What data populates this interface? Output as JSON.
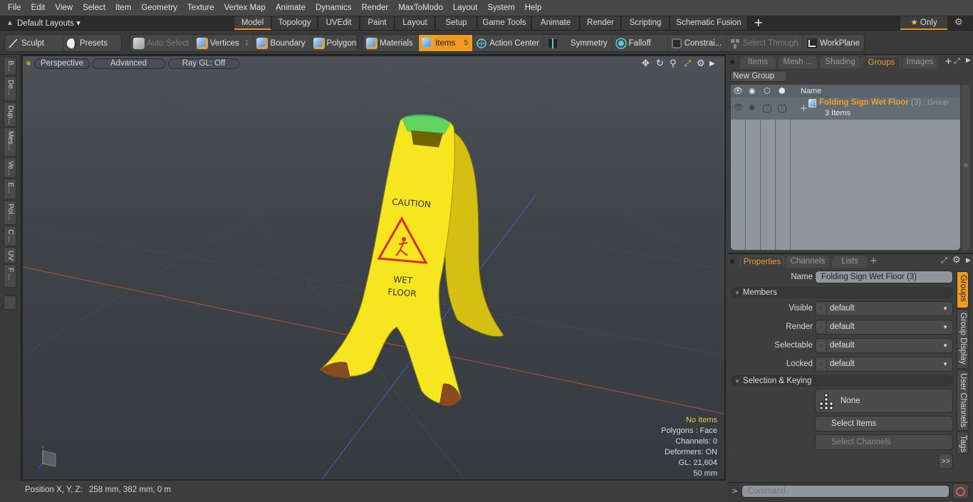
{
  "menu": [
    "File",
    "Edit",
    "View",
    "Select",
    "Item",
    "Geometry",
    "Texture",
    "Vertex Map",
    "Animate",
    "Dynamics",
    "Render",
    "MaxToModo",
    "Layout",
    "System",
    "Help"
  ],
  "layout_bar": {
    "layouts_label": "Default Layouts ▾",
    "tabs": [
      "Model",
      "Topology",
      "UVEdit",
      "Paint",
      "Layout",
      "Setup",
      "Game Tools",
      "Animate",
      "Render",
      "Scripting",
      "Schematic Fusion"
    ],
    "active_tab": "Model",
    "add_label": "+",
    "only_label": "Only",
    "only_star": "★",
    "gear": "⚙"
  },
  "toolbar": {
    "sculpt": "Sculpt",
    "presets": "Presets",
    "auto_select": "Auto Select",
    "vertices": "Vertices",
    "vertices_count": "1",
    "boundary": "Boundary",
    "polygons": "Polygons",
    "materials": "Materials",
    "items": "Items",
    "items_count": "5",
    "action_center": "Action Center",
    "symmetry": "Symmetry",
    "falloff": "Falloff",
    "constraints": "Constrai...",
    "select_through": "Select Through",
    "workplane": "WorkPlane"
  },
  "left_tabs": [
    "B...",
    "De...",
    "Dup...",
    "Mes...",
    "Ve...",
    "E...",
    "Pol...",
    "C ...",
    "UV",
    "F ..."
  ],
  "viewport": {
    "view_mode": "Perspective",
    "shading": "Advanced",
    "raygl": "Ray GL: Off",
    "icons": [
      "move-view-icon",
      "rotate-view-icon",
      "zoom-view-icon",
      "maximize-icon",
      "gear-icon",
      "play-arrow-icon"
    ],
    "stats": {
      "selection": "No Items",
      "mode": "Polygons : Face",
      "channels": "Channels: 0",
      "deformers": "Deformers: ON",
      "gl": "GL: 21,604",
      "grid": "50 mm"
    },
    "sign_text": {
      "caution": "CAUTION",
      "wet": "WET",
      "floor": "FLOOR"
    },
    "axis_labels": {
      "y": "Y",
      "x": "X",
      "z": "Z"
    }
  },
  "status_bar": {
    "position_label": "Position X, Y, Z:",
    "position_value": "258 mm, 382 mm, 0 m"
  },
  "groups_panel": {
    "tabs": [
      "Items",
      "Mesh ...",
      "Shading",
      "Groups",
      "Images"
    ],
    "active_tab": "Groups",
    "new_group": "New Group",
    "column_name": "Name",
    "row": {
      "name": "Folding Sign Wet Floor",
      "count": "(3)",
      "type": ": Group",
      "items": "3 Items",
      "expand": "+"
    }
  },
  "properties_panel": {
    "tabs": [
      "Properties",
      "Channels",
      "Lists"
    ],
    "active_tab": "Properties",
    "add": "+",
    "name_label": "Name",
    "name_value": "Folding Sign Wet Floor (3)",
    "members_section": "Members",
    "fields": [
      {
        "label": "Visible",
        "value": "default"
      },
      {
        "label": "Render",
        "value": "default"
      },
      {
        "label": "Selectable",
        "value": "default"
      },
      {
        "label": "Locked",
        "value": "default"
      }
    ],
    "selection_section": "Selection & Keying",
    "none_label": "None",
    "select_items": "Select Items",
    "select_channels": "Select Channels",
    "more": ">>",
    "side_tabs": [
      "Groups",
      "Group Display",
      "User Channels",
      "Tags"
    ],
    "active_side_tab": "Groups"
  },
  "command": {
    "prompt": ">",
    "placeholder": "Command"
  },
  "colors": {
    "accent": "#f09a20",
    "highlight_text": "#f0a030",
    "sign_yellow": "#f5e620",
    "sign_red": "#e02a1a"
  }
}
